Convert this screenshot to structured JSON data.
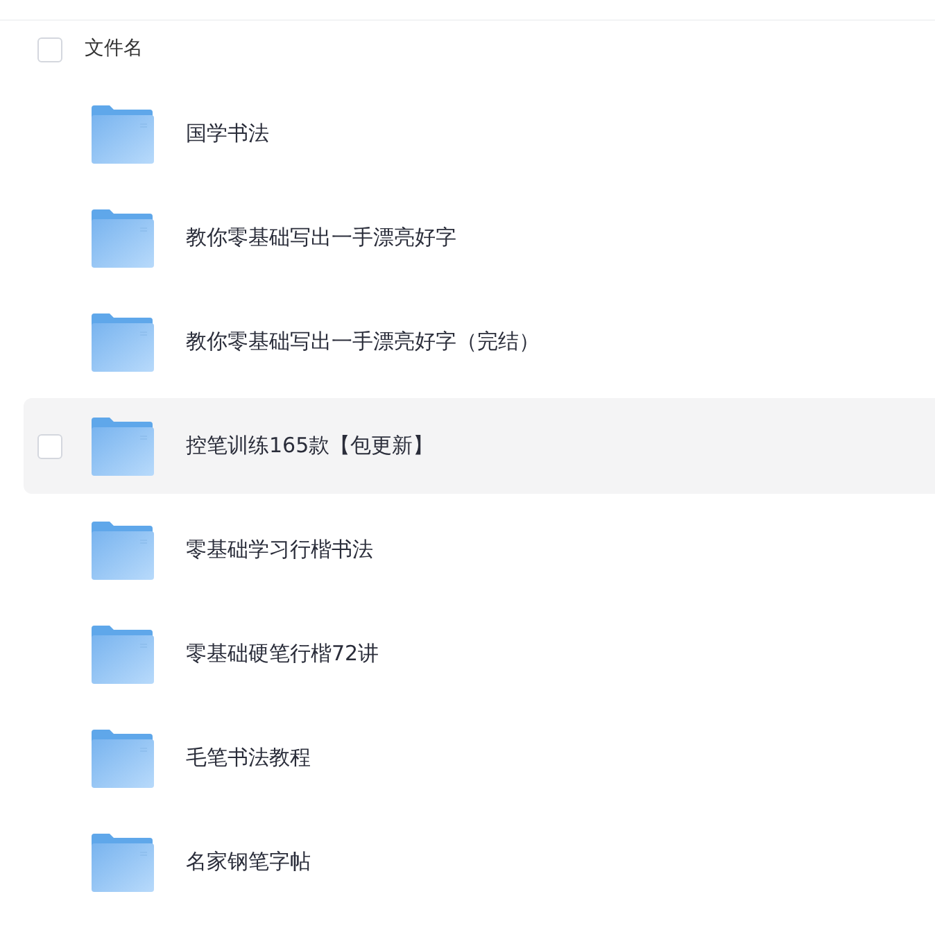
{
  "header": {
    "label": "文件名",
    "checked": false
  },
  "files": [
    {
      "name": "国学书法",
      "hovered": false
    },
    {
      "name": "教你零基础写出一手漂亮好字",
      "hovered": false
    },
    {
      "name": "教你零基础写出一手漂亮好字（完结）",
      "hovered": false
    },
    {
      "name": "控笔训练165款【包更新】",
      "hovered": true
    },
    {
      "name": "零基础学习行楷书法",
      "hovered": false
    },
    {
      "name": "零基础硬笔行楷72讲",
      "hovered": false
    },
    {
      "name": "毛笔书法教程",
      "hovered": false
    },
    {
      "name": "名家钢笔字帖",
      "hovered": false
    }
  ]
}
